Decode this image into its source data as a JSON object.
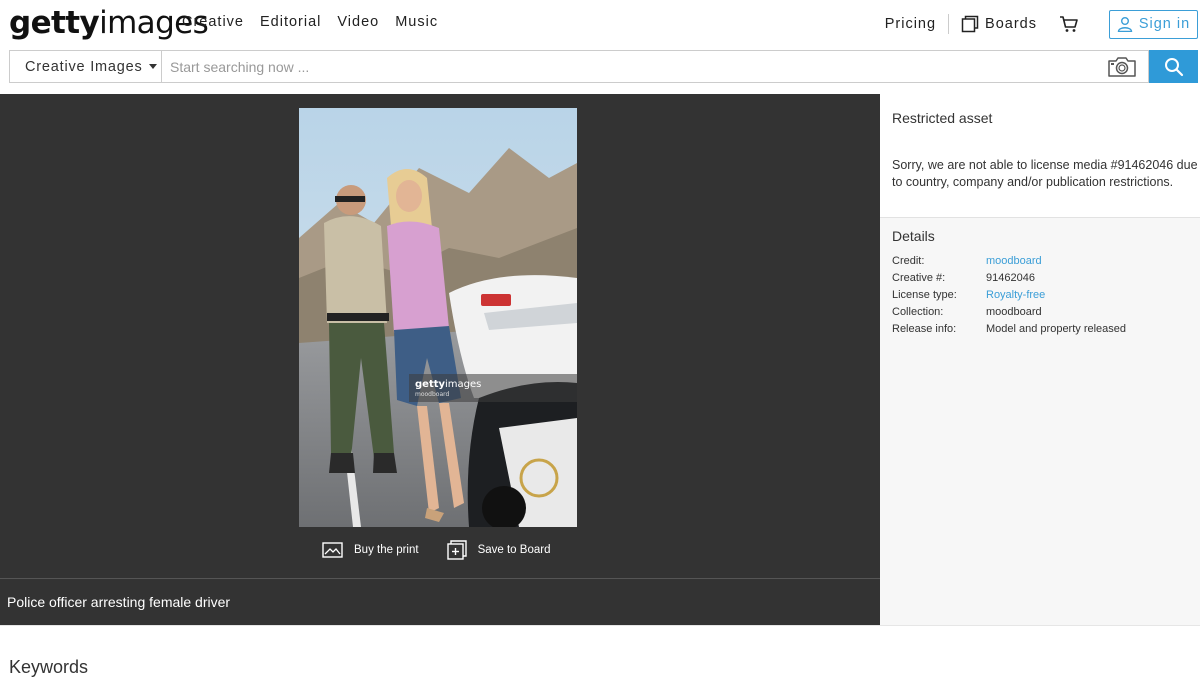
{
  "header": {
    "logo_bold": "getty",
    "logo_light": "images",
    "nav": [
      "Creative",
      "Editorial",
      "Video",
      "Music"
    ],
    "pricing": "Pricing",
    "boards": "Boards",
    "signin": "Sign in"
  },
  "search": {
    "scope": "Creative Images",
    "placeholder": "Start searching now ..."
  },
  "viewer": {
    "watermark_bold": "getty",
    "watermark_light": "images",
    "watermark_sub": "moodboard",
    "buy_print": "Buy the print",
    "save_board": "Save to Board",
    "caption": "Police officer arresting female driver"
  },
  "panel": {
    "restricted_title": "Restricted asset",
    "restricted_msg": "Sorry, we are not able to license media #91462046 due to country, company and/or publication restrictions.",
    "details_title": "Details",
    "details": [
      {
        "key": "Credit:",
        "value": "moodboard",
        "link": true
      },
      {
        "key": "Creative #:",
        "value": "91462046",
        "link": false
      },
      {
        "key": "License type:",
        "value": "Royalty-free",
        "link": true
      },
      {
        "key": "Collection:",
        "value": "moodboard",
        "link": false
      },
      {
        "key": "Release info:",
        "value": "Model and property released",
        "link": false
      }
    ]
  },
  "keywords_title": "Keywords",
  "colors": {
    "accent": "#3b9ed7",
    "search_button": "#2f9ad8",
    "viewer_bg": "#333333"
  }
}
